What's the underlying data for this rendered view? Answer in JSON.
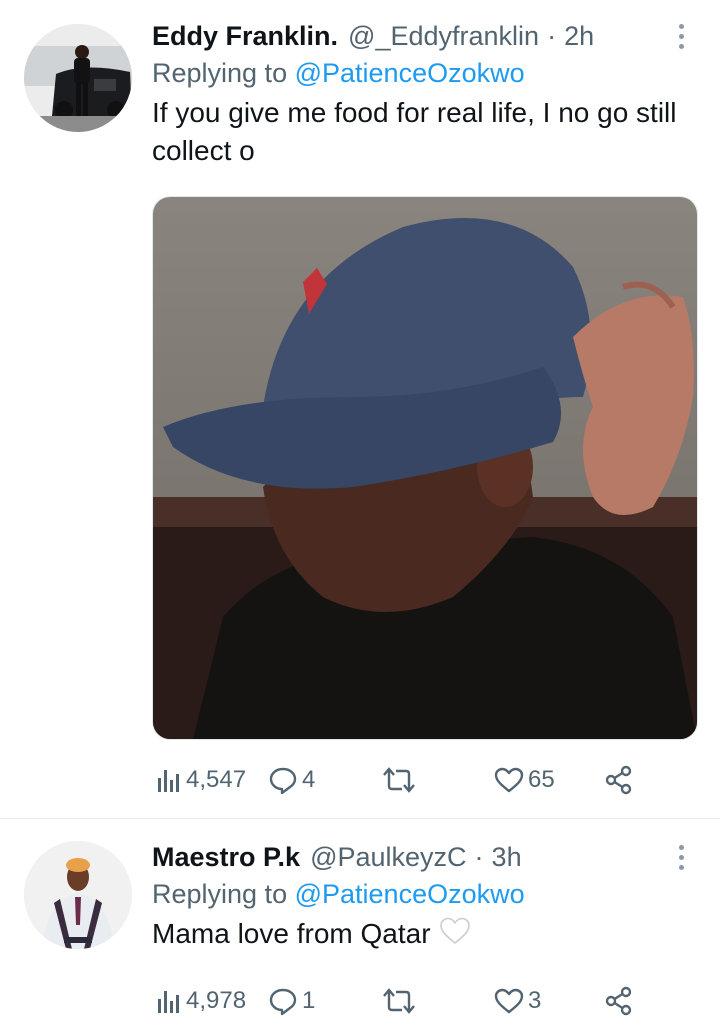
{
  "tweets": [
    {
      "author_name": "Eddy Franklin.",
      "handle": "@_Eddyfranklin",
      "separator": "·",
      "time": "2h",
      "replying_prefix": "Replying to",
      "replying_to": "@PatienceOzokwo",
      "text": "If you give me food for real life, I no go still collect o",
      "has_media": true,
      "stats": {
        "views": "4,547",
        "replies": "4",
        "retweets": "",
        "likes": "65"
      }
    },
    {
      "author_name": "Maestro P.k",
      "handle": "@PaulkeyzC",
      "separator": "·",
      "time": "3h",
      "replying_prefix": "Replying to",
      "replying_to": "@PatienceOzokwo",
      "text": "Mama love from Qatar",
      "emoji": "white-heart",
      "stats": {
        "views": "4,978",
        "replies": "1",
        "retweets": "",
        "likes": "3"
      }
    }
  ],
  "icons": {
    "views": "bar-chart-icon",
    "reply": "reply-icon",
    "retweet": "retweet-icon",
    "like": "heart-icon",
    "share": "share-icon",
    "more": "more-vertical-icon"
  },
  "colors": {
    "link": "#1d9bf0",
    "secondary_text": "#536471",
    "primary_text": "#0f1419",
    "divider": "#e6ecf0"
  }
}
